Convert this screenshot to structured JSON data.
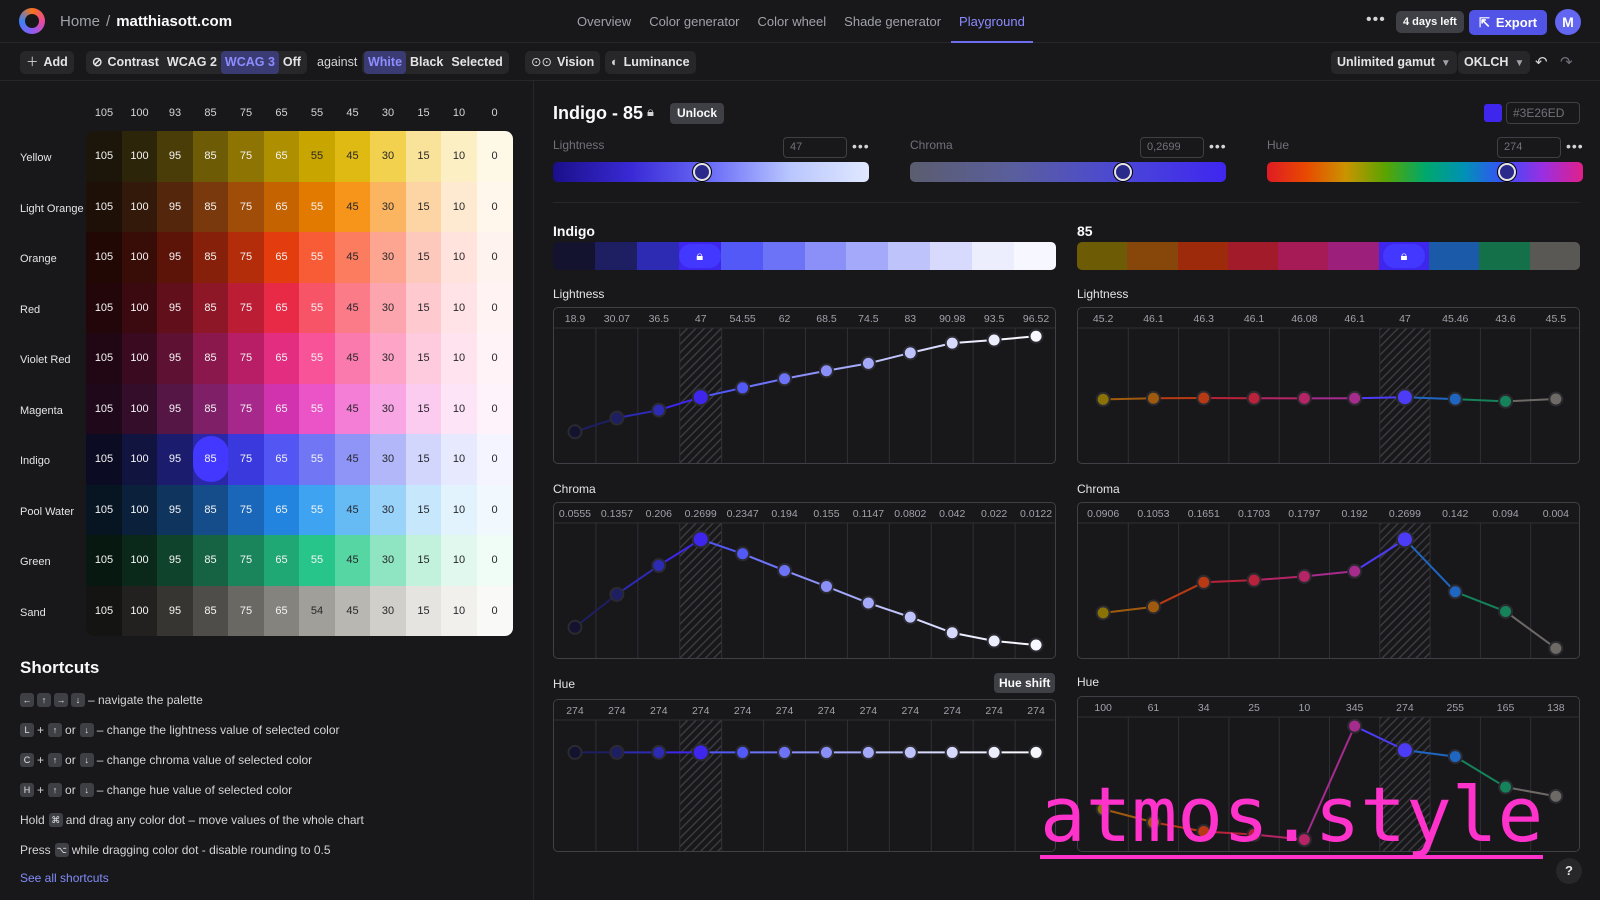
{
  "header": {
    "breadcrumb_home": "Home",
    "breadcrumb_sep": "/",
    "breadcrumb_site": "matthiasott.com",
    "nav": [
      "Overview",
      "Color generator",
      "Color wheel",
      "Shade generator",
      "Playground"
    ],
    "active_nav": "Playground",
    "more_icon": "ellipsis-icon",
    "days_left": "4 days left",
    "export_label": "Export",
    "avatar_initial": "M"
  },
  "toolbar": {
    "add_label": "Add",
    "contrast_label": "Contrast",
    "wcag_options": [
      "WCAG 2",
      "WCAG 3",
      "Off"
    ],
    "wcag_selected": "WCAG 3",
    "against_label": "against",
    "against_options": [
      "White",
      "Black",
      "Selected"
    ],
    "against_selected": "White",
    "vision_label": "Vision",
    "luminance_label": "Luminance",
    "gamut_label": "Unlimited gamut",
    "colorspace_label": "OKLCH"
  },
  "palette": {
    "column_headers": [
      "105",
      "100",
      "93",
      "85",
      "75",
      "65",
      "55",
      "45",
      "30",
      "15",
      "10",
      "0"
    ],
    "rows": [
      {
        "name": "Yellow",
        "values": [
          "105",
          "100",
          "95",
          "85",
          "75",
          "65",
          "55",
          "45",
          "30",
          "15",
          "10",
          "0"
        ],
        "colors": [
          "#1b1609",
          "#2d2509",
          "#4a3d07",
          "#6e5b06",
          "#8e7503",
          "#ae8f00",
          "#c9a500",
          "#dfba13",
          "#f2d14f",
          "#f9e39a",
          "#fcefc4",
          "#fef9e6"
        ]
      },
      {
        "name": "Light Orange",
        "values": [
          "105",
          "100",
          "95",
          "85",
          "75",
          "65",
          "55",
          "45",
          "30",
          "15",
          "10",
          "0"
        ],
        "colors": [
          "#1e1006",
          "#33190a",
          "#54270c",
          "#7a390c",
          "#9f4d09",
          "#c46300",
          "#e37a00",
          "#f7941a",
          "#fbb561",
          "#fdd5a4",
          "#feead0",
          "#fff6ec"
        ]
      },
      {
        "name": "Orange",
        "values": [
          "105",
          "100",
          "95",
          "85",
          "75",
          "65",
          "55",
          "45",
          "30",
          "15",
          "10",
          "0"
        ],
        "colors": [
          "#210805",
          "#380d08",
          "#5c1409",
          "#87200a",
          "#b32d0a",
          "#e23c0f",
          "#f85c36",
          "#fb7c5e",
          "#fda591",
          "#fec9bd",
          "#ffe3dc",
          "#fff3f0"
        ]
      },
      {
        "name": "Red",
        "values": [
          "105",
          "100",
          "95",
          "85",
          "75",
          "65",
          "55",
          "45",
          "30",
          "15",
          "10",
          "0"
        ],
        "colors": [
          "#22060a",
          "#3b0a11",
          "#600f1b",
          "#8d1627",
          "#bb1d35",
          "#e82a47",
          "#f85468",
          "#fb7b88",
          "#fda5ae",
          "#fecacf",
          "#ffe3e6",
          "#fff3f4"
        ]
      },
      {
        "name": "Violet Red",
        "values": [
          "105",
          "100",
          "95",
          "85",
          "75",
          "65",
          "55",
          "45",
          "30",
          "15",
          "10",
          "0"
        ],
        "colors": [
          "#210713",
          "#3a0b20",
          "#5e1133",
          "#8b184c",
          "#b81e66",
          "#e32d81",
          "#f85398",
          "#fb7aad",
          "#fda4c7",
          "#fecade",
          "#ffe3ee",
          "#fff3f8"
        ]
      },
      {
        "name": "Magenta",
        "values": [
          "105",
          "100",
          "95",
          "85",
          "75",
          "65",
          "55",
          "45",
          "30",
          "15",
          "10",
          "0"
        ],
        "colors": [
          "#1e0819",
          "#340d2b",
          "#551545",
          "#7e1f68",
          "#a7288b",
          "#d033ad",
          "#ea54c6",
          "#f47dd6",
          "#f9a6e4",
          "#fccbf0",
          "#fee4f7",
          "#fff3fb"
        ]
      },
      {
        "name": "Indigo",
        "values": [
          "105",
          "100",
          "95",
          "85",
          "75",
          "65",
          "55",
          "45",
          "30",
          "15",
          "10",
          "0"
        ],
        "colors": [
          "#0b0b24",
          "#121440",
          "#1b1c6e",
          "#2a28a8",
          "#3a39dd",
          "#5356f2",
          "#7176f5",
          "#8f95f7",
          "#b2b7fa",
          "#d2d5fc",
          "#e7e9fe",
          "#f4f5ff"
        ]
      },
      {
        "name": "Pool Water",
        "values": [
          "105",
          "100",
          "95",
          "85",
          "75",
          "65",
          "55",
          "45",
          "30",
          "15",
          "10",
          "0"
        ],
        "colors": [
          "#071422",
          "#0b213b",
          "#0f355f",
          "#154d8b",
          "#1a66b8",
          "#2384e0",
          "#3ea3f0",
          "#66bbf5",
          "#99d3f9",
          "#c6e7fc",
          "#e2f3fe",
          "#f1f9ff"
        ]
      },
      {
        "name": "Green",
        "values": [
          "105",
          "100",
          "95",
          "85",
          "75",
          "65",
          "55",
          "45",
          "30",
          "15",
          "10",
          "0"
        ],
        "colors": [
          "#071810",
          "#0b291b",
          "#0f432c",
          "#156342",
          "#1a855a",
          "#1fa873",
          "#28c58b",
          "#55d6a3",
          "#8fe5c1",
          "#c2f1dc",
          "#e0f8ed",
          "#f0fcf6"
        ]
      },
      {
        "name": "Sand",
        "values": [
          "105",
          "100",
          "95",
          "85",
          "75",
          "65",
          "54",
          "45",
          "30",
          "15",
          "10",
          "0"
        ],
        "colors": [
          "#141413",
          "#22211f",
          "#363532",
          "#4f4d49",
          "#6a6863",
          "#85837e",
          "#a19f99",
          "#b9b7b2",
          "#d1cfca",
          "#e5e4e0",
          "#f1f0ed",
          "#f9f9f7"
        ]
      }
    ],
    "selected": {
      "row": 6,
      "col": 3
    }
  },
  "shortcuts": {
    "title": "Shortcuts",
    "lines": [
      {
        "keys": [
          "←",
          "↑",
          "→",
          "↓"
        ],
        "text": "– navigate the palette"
      },
      {
        "keys": [
          "L",
          "+",
          "↑",
          "or",
          "↓"
        ],
        "text": "– change the lightness value of selected color"
      },
      {
        "keys": [
          "C",
          "+",
          "↑",
          "or",
          "↓"
        ],
        "text": "– change chroma value of selected color"
      },
      {
        "keys": [
          "H",
          "+",
          "↑",
          "or",
          "↓"
        ],
        "text": "– change hue value of selected color"
      },
      {
        "keys": [
          "Hold",
          "⌘"
        ],
        "text": "and drag any color dot – move values of the whole chart"
      },
      {
        "keys": [
          "Press",
          "⌥"
        ],
        "text": "while dragging color dot - disable rounding to 0.5"
      }
    ],
    "see_all": "See all shortcuts"
  },
  "editor": {
    "title": "Indigo - 85",
    "unlock_label": "Unlock",
    "hex": "#3E26ED",
    "swatch_color": "#3E26ED",
    "sliders": [
      {
        "label": "Lightness",
        "value": "47",
        "position": 0.47
      },
      {
        "label": "Chroma",
        "value": "0,2699",
        "position": 0.675
      },
      {
        "label": "Hue",
        "value": "274",
        "position": 0.761
      }
    ],
    "left_strip_title": "Indigo",
    "right_strip_title": "85",
    "left_strip_colors": [
      "#13132f",
      "#1e1f63",
      "#2d2ab3",
      "#3E26ED",
      "#5359f6",
      "#6d73f7",
      "#8a90f8",
      "#a4a9fa",
      "#bfc3fb",
      "#d7dafd",
      "#eceefe",
      "#f7f7ff"
    ],
    "right_strip_colors": [
      "#6e5b06",
      "#87460a",
      "#9e2a0c",
      "#a21b2a",
      "#a61b55",
      "#9c1f7c",
      "#3E26ED",
      "#1b5aa8",
      "#137049",
      "#5a5854"
    ]
  },
  "charts": {
    "indigo_lightness": {
      "title": "Lightness",
      "labels": [
        "18.9",
        "30.07",
        "36.5",
        "47",
        "54.55",
        "62",
        "68.5",
        "74.5",
        "83",
        "90.98",
        "93.5",
        "96.52"
      ],
      "values": [
        18.9,
        30.07,
        36.5,
        47,
        54.55,
        62,
        68.5,
        74.5,
        83,
        90.98,
        93.5,
        96.52
      ],
      "ylim": [
        0,
        100
      ]
    },
    "indigo_chroma": {
      "title": "Chroma",
      "labels": [
        "0.0555",
        "0.1357",
        "0.206",
        "0.2699",
        "0.2347",
        "0.194",
        "0.155",
        "0.1147",
        "0.0802",
        "0.042",
        "0.022",
        "0.0122"
      ],
      "values": [
        0.0555,
        0.1357,
        0.206,
        0.2699,
        0.2347,
        0.194,
        0.155,
        0.1147,
        0.0802,
        0.042,
        0.022,
        0.0122
      ],
      "ylim": [
        0,
        0.3
      ]
    },
    "indigo_hue": {
      "title": "Hue",
      "hue_shift_label": "Hue shift",
      "labels": [
        "274",
        "274",
        "274",
        "274",
        "274",
        "274",
        "274",
        "274",
        "274",
        "274",
        "274",
        "274"
      ],
      "values": [
        274,
        274,
        274,
        274,
        274,
        274,
        274,
        274,
        274,
        274,
        274,
        274
      ],
      "ylim": [
        0,
        360
      ]
    },
    "shade_lightness": {
      "title": "Lightness",
      "labels": [
        "45.2",
        "46.1",
        "46.3",
        "46.1",
        "46.08",
        "46.1",
        "47",
        "45.46",
        "43.6",
        "45.5"
      ],
      "values": [
        45.2,
        46.1,
        46.3,
        46.1,
        46.08,
        46.1,
        47,
        45.46,
        43.6,
        45.5
      ],
      "ylim": [
        0,
        100
      ]
    },
    "shade_chroma": {
      "title": "Chroma",
      "labels": [
        "0.0906",
        "0.1053",
        "0.1651",
        "0.1703",
        "0.1797",
        "0.192",
        "0.2699",
        "0.142",
        "0.094",
        "0.004"
      ],
      "values": [
        0.0906,
        0.1053,
        0.1651,
        0.1703,
        0.1797,
        0.192,
        0.2699,
        0.142,
        0.094,
        0.004
      ],
      "ylim": [
        0,
        0.3
      ]
    },
    "shade_hue": {
      "title": "Hue",
      "labels": [
        "100",
        "61",
        "34",
        "25",
        "10",
        "345",
        "274",
        "255",
        "165",
        "138"
      ],
      "values": [
        100,
        61,
        34,
        25,
        10,
        345,
        274,
        255,
        165,
        138
      ],
      "ylim": [
        0,
        360
      ]
    }
  },
  "watermark": "atmos.style",
  "help_label": "?"
}
